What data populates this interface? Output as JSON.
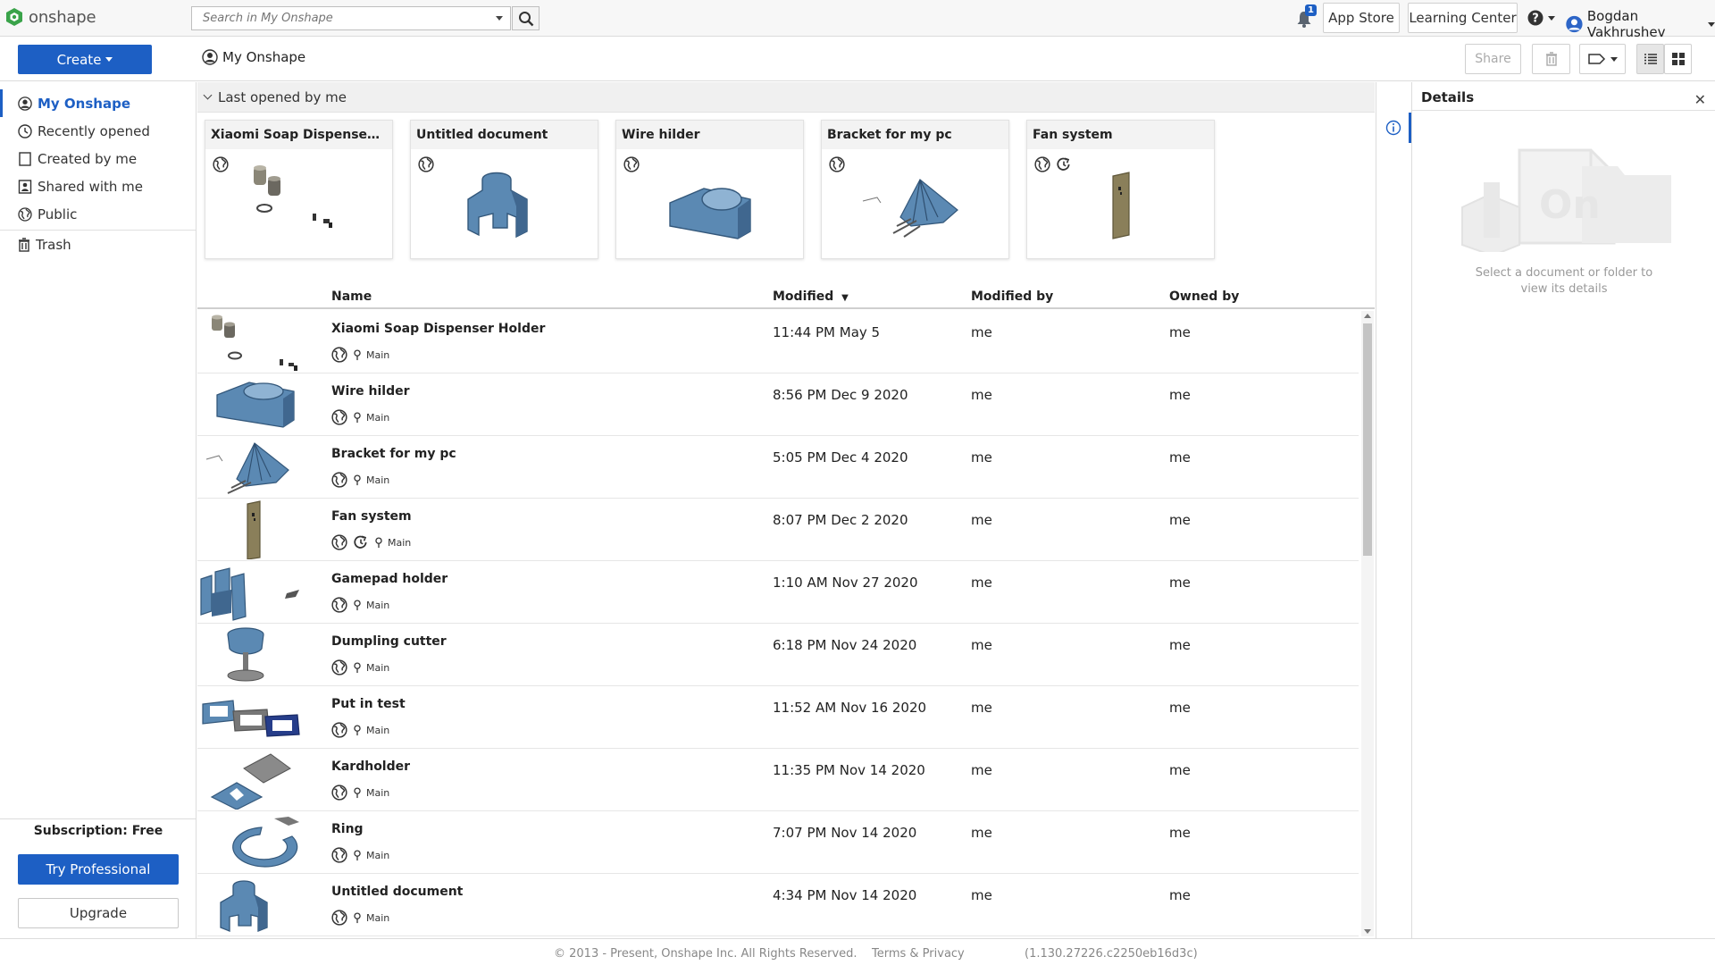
{
  "topbar": {
    "logo_text": "onshape",
    "search_placeholder": "Search in My Onshape",
    "notification_count": "1",
    "app_store": "App Store",
    "learning_center": "Learning Center",
    "user_name": "Bogdan Vakhrushev"
  },
  "subbar": {
    "create_label": "Create",
    "breadcrumb": "My Onshape",
    "share_label": "Share"
  },
  "sidebar": {
    "items": [
      {
        "label": "My Onshape",
        "icon": "user-circle-icon"
      },
      {
        "label": "Recently opened",
        "icon": "clock-icon"
      },
      {
        "label": "Created by me",
        "icon": "document-icon"
      },
      {
        "label": "Shared with me",
        "icon": "shared-icon"
      },
      {
        "label": "Public",
        "icon": "globe-icon"
      },
      {
        "label": "Trash",
        "icon": "trash-icon"
      }
    ],
    "subscription": "Subscription: Free",
    "try_professional": "Try Professional",
    "upgrade": "Upgrade"
  },
  "recent": {
    "heading": "Last opened by me",
    "cards": [
      {
        "title": "Xiaomi Soap Dispenser Hol...",
        "icons": [
          "globe-icon"
        ]
      },
      {
        "title": "Untitled document",
        "icons": [
          "globe-icon"
        ]
      },
      {
        "title": "Wire hilder",
        "icons": [
          "globe-icon"
        ]
      },
      {
        "title": "Bracket for my pc",
        "icons": [
          "globe-icon"
        ]
      },
      {
        "title": "Fan system",
        "icons": [
          "globe-icon",
          "history-icon"
        ]
      }
    ]
  },
  "table": {
    "columns": {
      "name": "Name",
      "modified": "Modified",
      "modified_by": "Modified by",
      "owned_by": "Owned by"
    },
    "rows": [
      {
        "name": "Xiaomi Soap Dispenser Holder",
        "branch": "Main",
        "modified": "11:44 PM May 5",
        "modified_by": "me",
        "owned_by": "me"
      },
      {
        "name": "Wire hilder",
        "branch": "Main",
        "modified": "8:56 PM Dec 9 2020",
        "modified_by": "me",
        "owned_by": "me"
      },
      {
        "name": "Bracket for my pc",
        "branch": "Main",
        "modified": "5:05 PM Dec 4 2020",
        "modified_by": "me",
        "owned_by": "me"
      },
      {
        "name": "Fan system",
        "branch": "Main",
        "modified": "8:07 PM Dec 2 2020",
        "modified_by": "me",
        "owned_by": "me"
      },
      {
        "name": "Gamepad holder",
        "branch": "Main",
        "modified": "1:10 AM Nov 27 2020",
        "modified_by": "me",
        "owned_by": "me"
      },
      {
        "name": "Dumpling cutter",
        "branch": "Main",
        "modified": "6:18 PM Nov 24 2020",
        "modified_by": "me",
        "owned_by": "me"
      },
      {
        "name": "Put in test",
        "branch": "Main",
        "modified": "11:52 AM Nov 16 2020",
        "modified_by": "me",
        "owned_by": "me"
      },
      {
        "name": "Kardholder",
        "branch": "Main",
        "modified": "11:35 PM Nov 14 2020",
        "modified_by": "me",
        "owned_by": "me"
      },
      {
        "name": "Ring",
        "branch": "Main",
        "modified": "7:07 PM Nov 14 2020",
        "modified_by": "me",
        "owned_by": "me"
      },
      {
        "name": "Untitled document",
        "branch": "Main",
        "modified": "4:34 PM Nov 14 2020",
        "modified_by": "me",
        "owned_by": "me"
      }
    ]
  },
  "details": {
    "title": "Details",
    "empty_message_line1": "Select a document or folder to",
    "empty_message_line2": "view its details"
  },
  "footer": {
    "copyright": "© 2013 - Present, Onshape Inc. All Rights Reserved.",
    "terms": "Terms & Privacy",
    "version": "(1.130.27226.c2250eb16d3c)"
  },
  "colors": {
    "accent": "#1d5fc4",
    "part_blue": "#5b89b3"
  }
}
